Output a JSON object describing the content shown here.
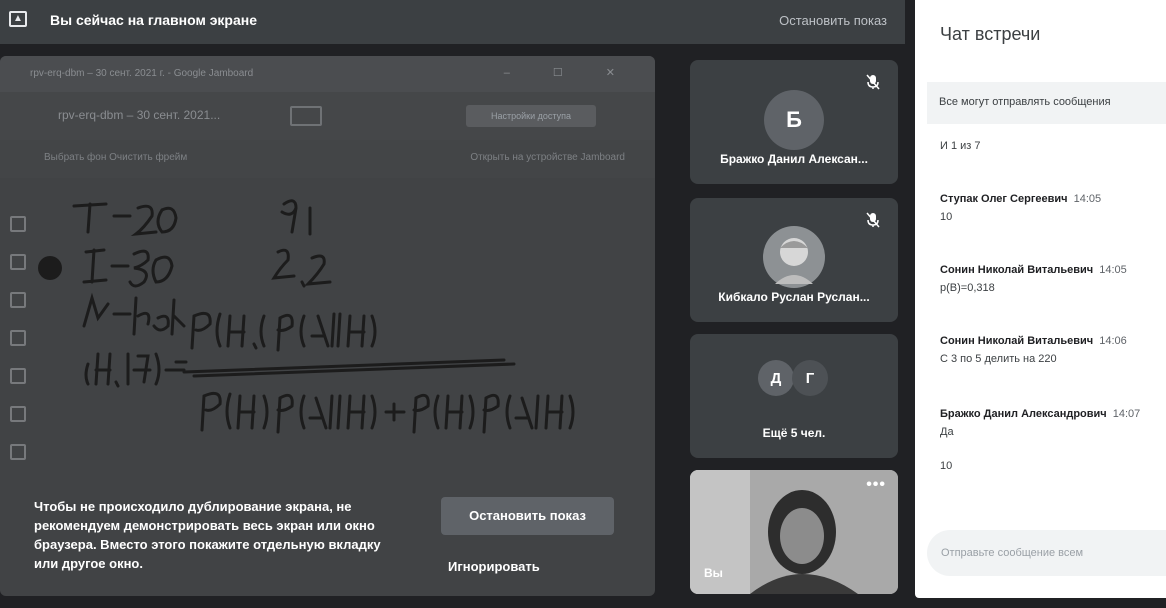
{
  "topbar": {
    "title": "Вы сейчас на главном экране",
    "stop_label": "Остановить показ"
  },
  "shared": {
    "browser_tab": "rpv-erq-dbm – 30 сент. 2021 г. - Google Jamboard",
    "doc_title": "rpv-erq-dbm – 30 сент. 2021...",
    "access_label": "Настройки доступа",
    "toolbar_left": "Выбрать фон   Очистить фрейм",
    "toolbar_right": "Открыть на устройстве Jamboard"
  },
  "notice": {
    "text": "Чтобы не происходило дублирование экрана, не рекомендуем демонстрировать весь экран или окно браузера. Вместо этого покажите отдельную вкладку или другое окно.",
    "stop_label": "Остановить показ",
    "ignore_label": "Игнорировать"
  },
  "participants": [
    {
      "name": "Бражко Данил Алексан...",
      "initial": "Б"
    },
    {
      "name": "Кибкало Руслан Руслан..."
    }
  ],
  "more": {
    "initials": [
      "Д",
      "Г"
    ],
    "label": "Ещё 5 чел."
  },
  "self": {
    "label": "Вы"
  },
  "chat": {
    "title": "Чат встречи",
    "banner": "Все могут отправлять сообщения",
    "loose": "И 1 из 7",
    "messages": [
      {
        "author": "Ступак Олег Сергеевич",
        "time": "14:05",
        "text": "10"
      },
      {
        "author": "Сонин Николай Витальевич",
        "time": "14:05",
        "text": "р(В)=0,318"
      },
      {
        "author": "Сонин Николай Витальевич",
        "time": "14:06",
        "text": "С 3 по 5 делить на 220"
      },
      {
        "author": "Бражко Данил Александрович",
        "time": "14:07",
        "text": "Да"
      }
    ],
    "trailing": "10",
    "placeholder": "Отправьте сообщение всем"
  }
}
